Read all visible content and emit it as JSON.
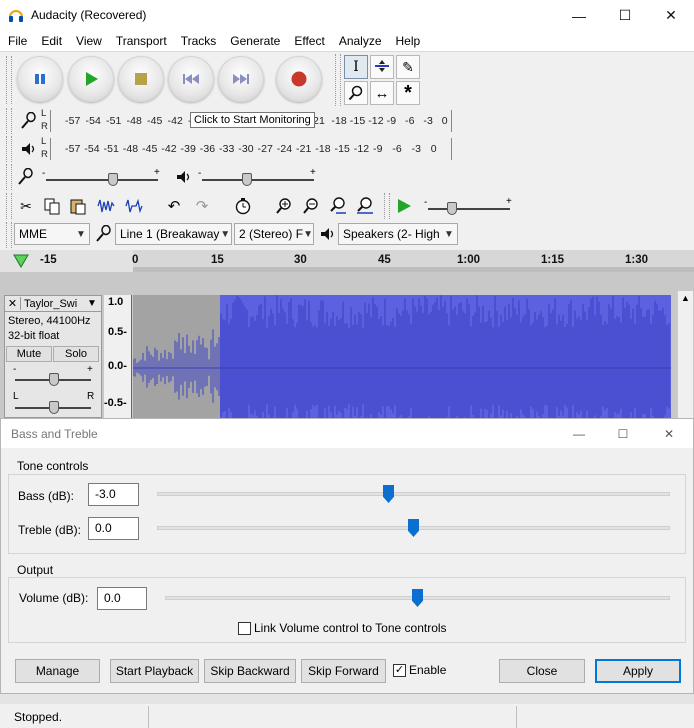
{
  "window": {
    "title": "Audacity (Recovered)",
    "minimize_glyph": "—",
    "maximize_glyph": "☐",
    "close_glyph": "✕"
  },
  "menu": {
    "items": [
      "File",
      "Edit",
      "View",
      "Transport",
      "Tracks",
      "Generate",
      "Effect",
      "Analyze",
      "Help"
    ]
  },
  "meters": {
    "record_channels": [
      "L",
      "R"
    ],
    "playback_channels": [
      "L",
      "R"
    ],
    "scale_left": [
      "-57",
      "-54",
      "-51",
      "-48",
      "-45",
      "-42",
      "-3"
    ],
    "scale_right_record": [
      "21",
      "-18",
      "-15",
      "-12",
      "-9",
      "-6",
      "-3",
      "0"
    ],
    "scale_playback": [
      "-57",
      "-54",
      "-51",
      "-48",
      "-45",
      "-42",
      "-39",
      "-36",
      "-33",
      "-30",
      "-27",
      "-24",
      "-21",
      "-18",
      "-15",
      "-12",
      "-9",
      "-6",
      "-3",
      "0"
    ],
    "tooltip": "Click to Start Monitoring"
  },
  "mixer": {
    "record_volume": 0.6,
    "playback_volume": 0.4
  },
  "device": {
    "host": "MME",
    "recording_device": "Line 1 (Breakaway",
    "channels": "2 (Stereo) F",
    "playback_device": "Speakers (2- High"
  },
  "timeline": {
    "labels": [
      "-15",
      "0",
      "15",
      "30",
      "45",
      "1:00",
      "1:15",
      "1:30"
    ]
  },
  "track": {
    "close_glyph": "✕",
    "name": "Taylor_Swi",
    "format_line1": "Stereo, 44100Hz",
    "format_line2": "32-bit float",
    "mute": "Mute",
    "solo": "Solo",
    "gain_minus": "-",
    "gain_plus": "+",
    "pan_left": "L",
    "pan_right": "R",
    "gain_level": 0.5,
    "pan_level": 0.5,
    "vruler": [
      "1.0",
      "0.5-",
      "0.0-",
      "-0.5-"
    ]
  },
  "dialog": {
    "title": "Bass and Treble",
    "tone_group": "Tone controls",
    "bass_label": "Bass (dB):",
    "bass_value": "-3.0",
    "bass_level": 0.45,
    "treble_label": "Treble (dB):",
    "treble_value": "0.0",
    "treble_level": 0.5,
    "output_group": "Output",
    "volume_label": "Volume (dB):",
    "volume_value": "0.0",
    "volume_level": 0.5,
    "link_label": "Link Volume control to Tone controls",
    "link_checked": false,
    "buttons": {
      "manage": "Manage",
      "start_playback": "Start Playback",
      "skip_backward": "Skip Backward",
      "skip_forward": "Skip Forward",
      "enable": "Enable",
      "close": "Close",
      "apply": "Apply"
    },
    "enable_checked": true,
    "check_glyph": "✓"
  },
  "status": {
    "text": "Stopped."
  },
  "colors": {
    "waveform": "#5c61e0",
    "waveform_selected_bg": "#a3a3a3",
    "accent": "#0a6fd1"
  }
}
